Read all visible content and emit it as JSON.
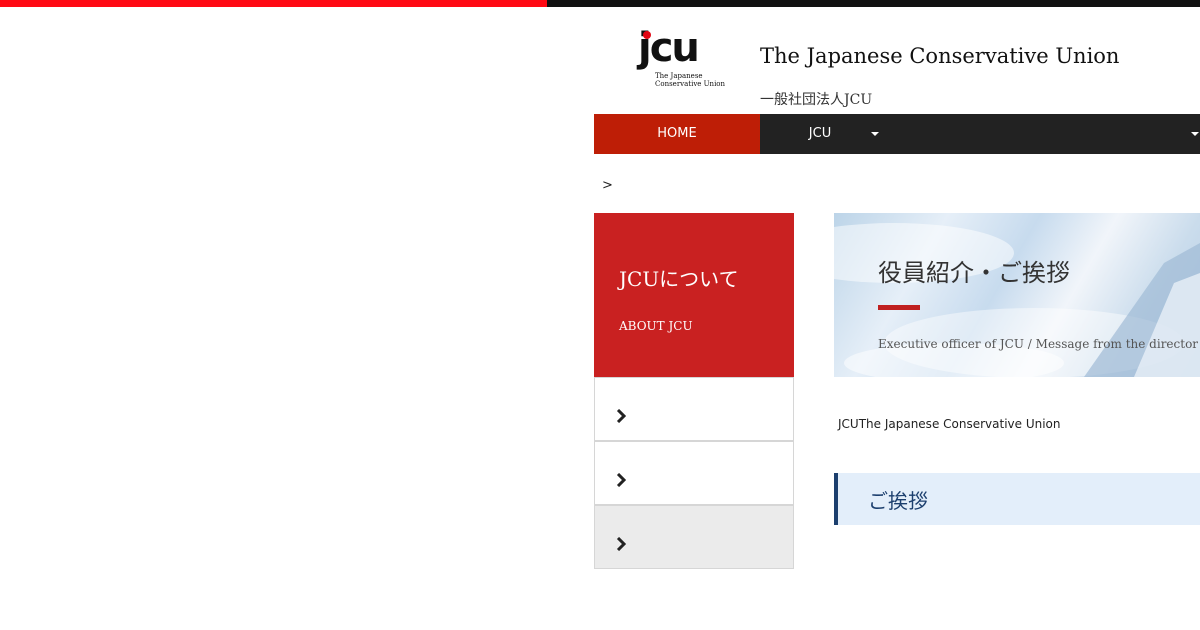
{
  "header": {
    "logo": {
      "mark": "jcu",
      "sub_line1": "The Japanese",
      "sub_line2": "Conservative Union"
    },
    "title": "The Japanese Conservative Union",
    "subtitle": "一般社団法人JCU"
  },
  "nav": {
    "items": [
      {
        "label": "HOME",
        "active": true
      },
      {
        "label": "JCU",
        "has_dropdown": true
      },
      {
        "label": "",
        "has_dropdown": true
      }
    ]
  },
  "breadcrumb": {
    "separator": ">"
  },
  "sidebar": {
    "title": "JCUについて",
    "subtitle": "ABOUT JCU",
    "items": [
      {
        "icon": "chevron-right-icon",
        "active": false
      },
      {
        "icon": "chevron-right-icon",
        "active": false
      },
      {
        "icon": "chevron-right-icon",
        "active": true
      }
    ]
  },
  "hero": {
    "title": "役員紹介・ご挨拶",
    "subtitle": "Executive officer of JCU / Message from the director"
  },
  "content": {
    "intro": "JCUThe Japanese Conservative Union",
    "section_title": "ご挨拶"
  },
  "colors": {
    "accent_red": "#c92121",
    "nav_active": "#be1e06",
    "nav_bg": "#222222",
    "top_bar_red": "#ff0a14",
    "section_navy": "#1c3f6e",
    "section_bg": "#e3eefa"
  }
}
